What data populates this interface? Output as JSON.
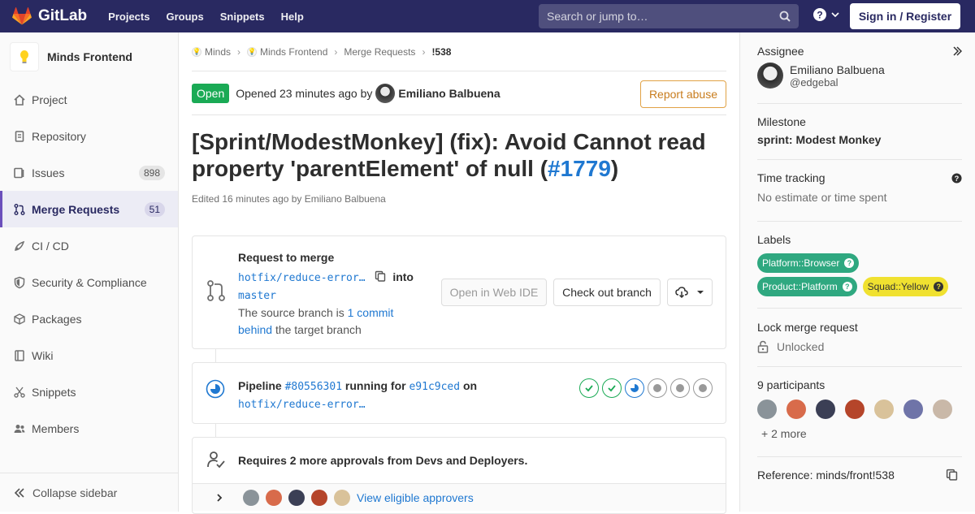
{
  "navbar": {
    "brand": "GitLab",
    "links": [
      "Projects",
      "Groups",
      "Snippets",
      "Help"
    ],
    "search_placeholder": "Search or jump to…",
    "signin": "Sign in / Register"
  },
  "sidebar": {
    "project_name": "Minds Frontend",
    "items": [
      {
        "label": "Project",
        "icon": "home-icon"
      },
      {
        "label": "Repository",
        "icon": "doc-icon"
      },
      {
        "label": "Issues",
        "icon": "issues-icon",
        "count": "898"
      },
      {
        "label": "Merge Requests",
        "icon": "merge-request-icon",
        "count": "51",
        "active": true
      },
      {
        "label": "CI / CD",
        "icon": "rocket-icon"
      },
      {
        "label": "Security & Compliance",
        "icon": "shield-icon"
      },
      {
        "label": "Packages",
        "icon": "package-icon"
      },
      {
        "label": "Wiki",
        "icon": "book-icon"
      },
      {
        "label": "Snippets",
        "icon": "scissors-icon"
      },
      {
        "label": "Members",
        "icon": "users-icon"
      }
    ],
    "collapse": "Collapse sidebar"
  },
  "breadcrumb": [
    "Minds",
    "Minds Frontend",
    "Merge Requests",
    "!538"
  ],
  "mr": {
    "status": "Open",
    "opened": "Opened 23 minutes ago by",
    "author": "Emiliano Balbuena",
    "report": "Report abuse",
    "title_prefix": "[Sprint/ModestMonkey] (fix): Avoid Cannot read property 'parentElement' of null (",
    "title_link": "#1779",
    "title_suffix": ")",
    "edited": "Edited 16 minutes ago by Emiliano Balbuena"
  },
  "merge_widget": {
    "heading": "Request to merge",
    "source_branch": "hotfix/reduce-error…",
    "into": "into",
    "target_branch": "master",
    "behind_prefix": "The source branch is",
    "behind_link": "1 commit behind",
    "behind_suffix": "the target branch",
    "web_ide": "Open in Web IDE",
    "checkout": "Check out branch"
  },
  "pipeline_widget": {
    "label": "Pipeline",
    "id": "#80556301",
    "running_for": "running for",
    "commit": "e91c9ced",
    "on": "on",
    "branch": "hotfix/reduce-error…",
    "stages": [
      "success",
      "success",
      "running",
      "created",
      "created",
      "created"
    ]
  },
  "approval_widget": {
    "text": "Requires 2 more approvals from Devs and Deployers.",
    "link": "View eligible approvers"
  },
  "right": {
    "assignee_title": "Assignee",
    "assignee_name": "Emiliano Balbuena",
    "assignee_handle": "@edgebal",
    "milestone_title": "Milestone",
    "milestone": "sprint: Modest Monkey",
    "time_title": "Time tracking",
    "time_value": "No estimate or time spent",
    "labels_title": "Labels",
    "labels": [
      {
        "text": "Platform::Browser",
        "color": "#2fa880"
      },
      {
        "text": "Product::Platform",
        "color": "#2fa880"
      },
      {
        "text": "Squad::Yellow",
        "color": "#f0e130"
      }
    ],
    "lock_title": "Lock merge request",
    "lock_value": "Unlocked",
    "participants_title": "9 participants",
    "more": "+ 2 more",
    "reference": "Reference: minds/front!538"
  }
}
